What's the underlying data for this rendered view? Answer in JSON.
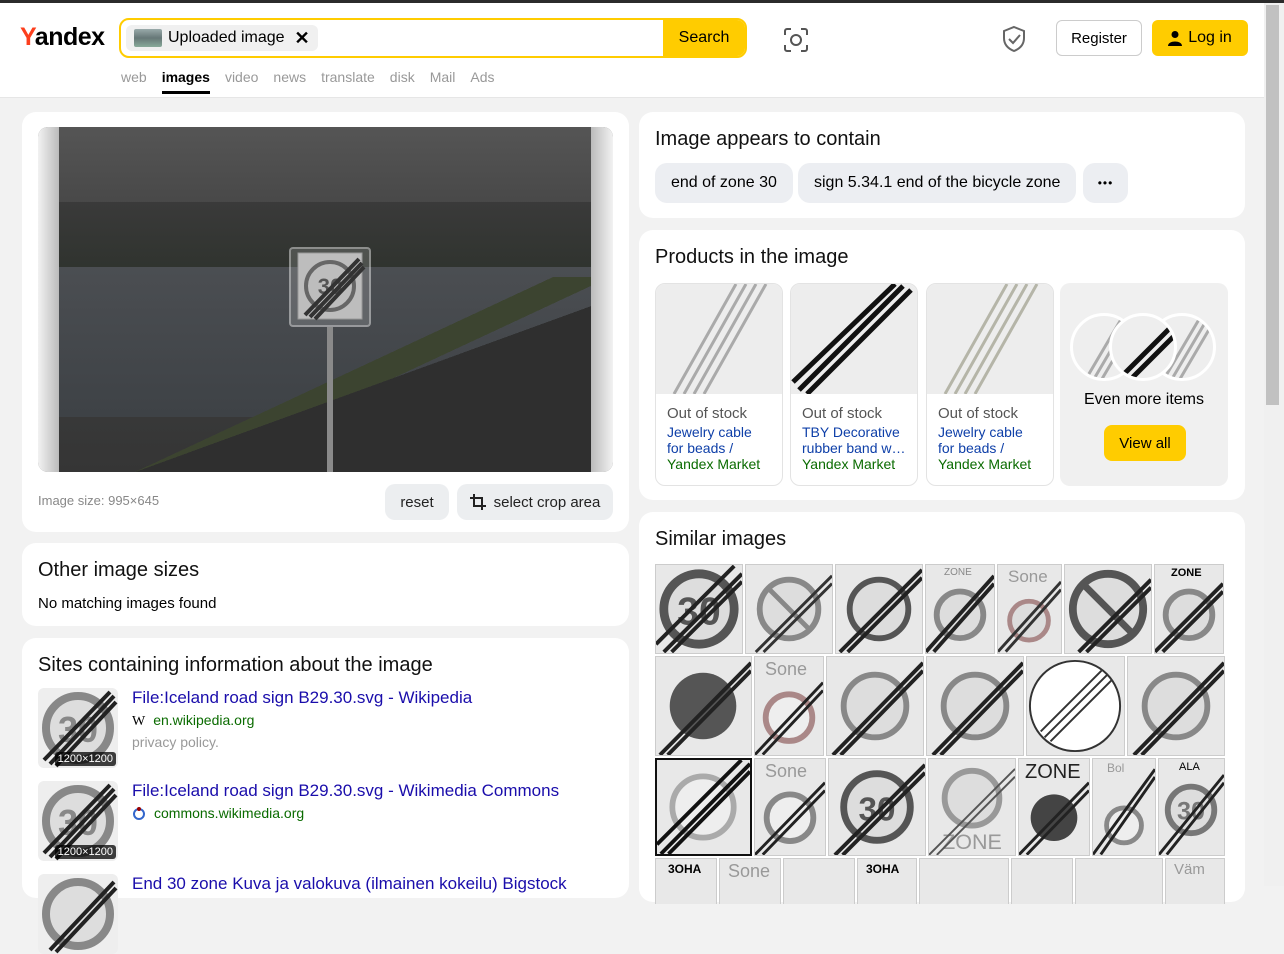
{
  "header": {
    "logo": {
      "y": "Y",
      "rest": "andex"
    },
    "search_chip": "Uploaded image",
    "search_button": "Search",
    "register": "Register",
    "login": "Log in",
    "nav": [
      "web",
      "images",
      "video",
      "news",
      "translate",
      "disk",
      "Mail",
      "Ads"
    ],
    "nav_active": "images"
  },
  "image_panel": {
    "size_text": "Image size: 995×645",
    "reset": "reset",
    "crop": "select crop area"
  },
  "other_sizes": {
    "title": "Other image sizes",
    "text": "No matching images found"
  },
  "sites": {
    "title": "Sites containing information about the image",
    "items": [
      {
        "title": "File:Iceland road sign B29.30.svg - Wikipedia",
        "url": "en.wikipedia.org",
        "desc": "privacy policy.",
        "dim": "1200×1200",
        "favicon": "W"
      },
      {
        "title": "File:Iceland road sign B29.30.svg - Wikimedia Commons",
        "url": "commons.wikimedia.org",
        "desc": "",
        "dim": "1200×1200",
        "favicon": "wikimedia-icon"
      },
      {
        "title": "End 30 zone Kuva ja valokuva (ilmainen kokeilu) Bigstock",
        "url": "",
        "desc": "",
        "dim": "",
        "favicon": ""
      }
    ]
  },
  "contains": {
    "title": "Image appears to contain",
    "tags": [
      "end of zone 30",
      "sign 5.34.1 end of the bicycle zone"
    ],
    "more": "•••"
  },
  "products": {
    "title": "Products in the image",
    "items": [
      {
        "stock": "Out of stock",
        "title": "Jewelry cable for beads / beads…",
        "shop": "Yandex Market"
      },
      {
        "stock": "Out of stock",
        "title": "TBY Decorative rubber band w…",
        "shop": "Yandex Market"
      },
      {
        "stock": "Out of stock",
        "title": "Jewelry cable for beads / beads…",
        "shop": "Yandex Market"
      }
    ],
    "more_label": "Even more items",
    "view_all": "View all"
  },
  "similar": {
    "title": "Similar images",
    "tile_labels": [
      "ZONE",
      "Sone",
      "ZONE",
      "Sone",
      "Sone",
      "ZONE",
      "ZONE",
      "Bol",
      "ALA",
      "3OHA",
      "Sone",
      "3OHA",
      "Väm"
    ]
  },
  "colors": {
    "accent": "#ffcc00",
    "logo_red": "#fc3f1d",
    "link": "#1a0dab",
    "url_green": "#0a6b00"
  }
}
